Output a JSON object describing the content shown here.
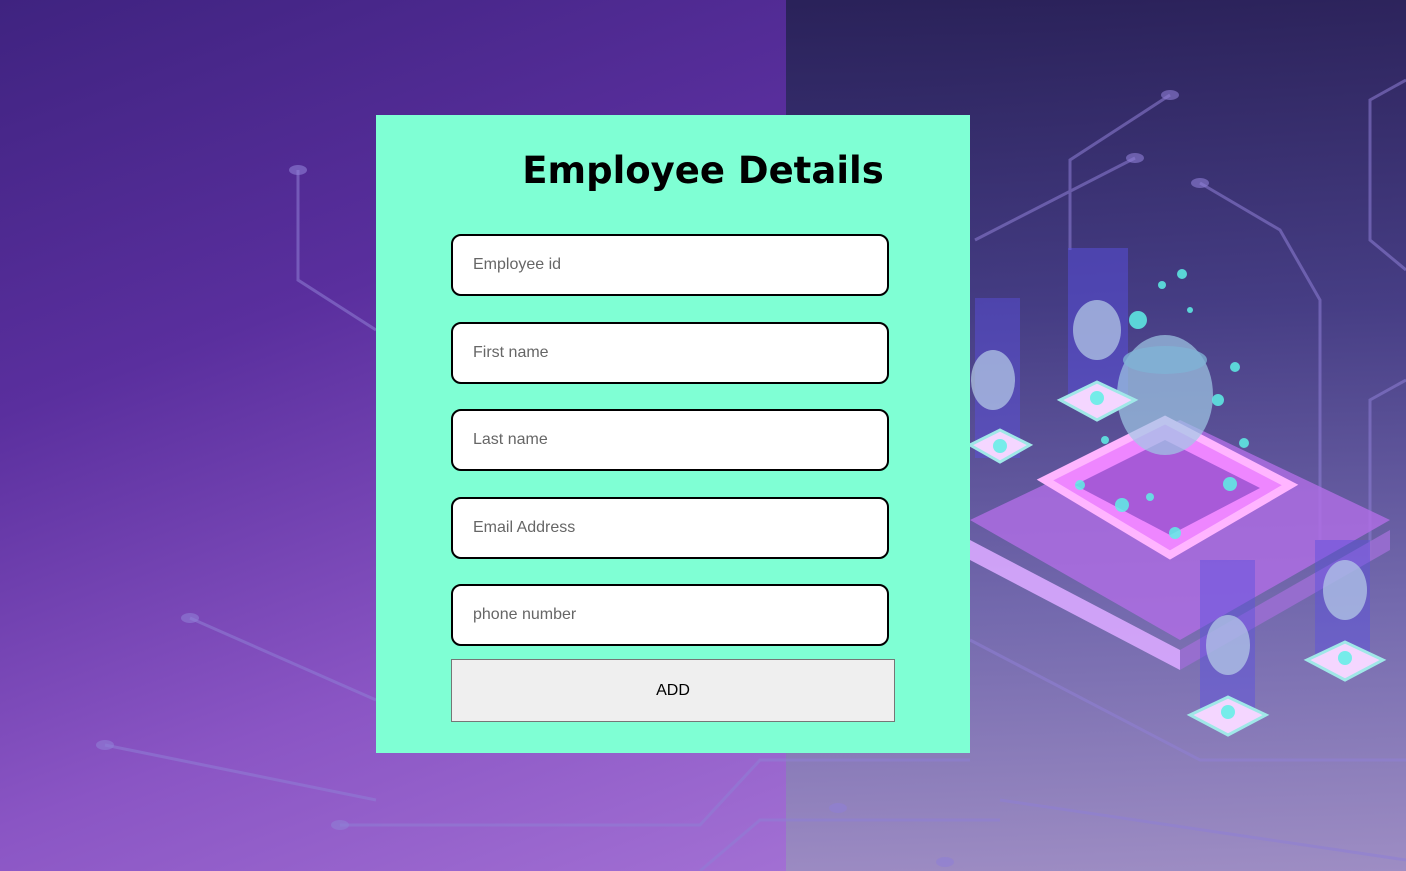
{
  "form": {
    "title": "Employee Details",
    "fields": [
      {
        "name": "employee-id",
        "placeholder": "Employee id",
        "value": ""
      },
      {
        "name": "first-name",
        "placeholder": "First name",
        "value": ""
      },
      {
        "name": "last-name",
        "placeholder": "Last name",
        "value": ""
      },
      {
        "name": "email-address",
        "placeholder": "Email Address",
        "value": ""
      },
      {
        "name": "phone-number",
        "placeholder": "phone number",
        "value": ""
      }
    ],
    "add_label": "ADD"
  },
  "colors": {
    "card_background": "#7fffd4",
    "button_background": "#efefef",
    "background_purple": "#5a2f9e"
  }
}
